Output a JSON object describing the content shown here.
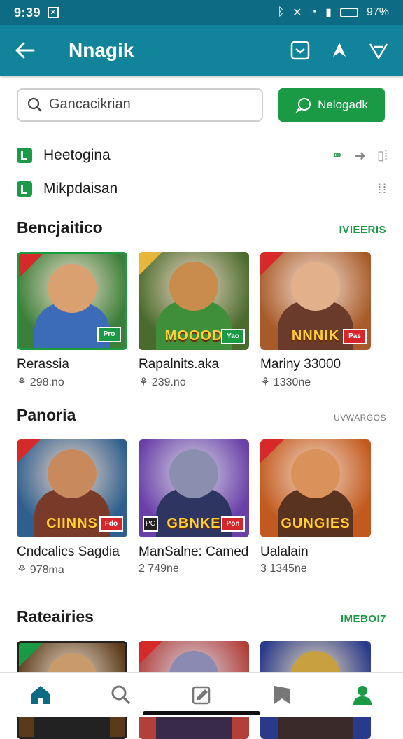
{
  "status_bar": {
    "time": "9:39",
    "battery": "97%"
  },
  "app_bar": {
    "title": "Nnagik"
  },
  "search": {
    "placeholder": "Gancacikrian"
  },
  "cta": {
    "label": "Nelogadk"
  },
  "links": [
    {
      "label": "Heetogina",
      "icon": "green-square-icon"
    },
    {
      "label": "Mikpdaisan",
      "icon": "green-square-icon"
    }
  ],
  "sections": [
    {
      "title": "Bencjaitico",
      "more": "IVIEERIS",
      "cards": [
        {
          "name": "Rerassia",
          "meta": "⚘ 298.no",
          "colors": {
            "bg": "#3b7f3a",
            "hero": "#d9a070",
            "body": "#3c6bb8"
          },
          "logo": "",
          "badge": "Pro",
          "badge_style": "green",
          "selected": true
        },
        {
          "name": "Rapalnits.aka",
          "meta": "⚘ 239.no",
          "colors": {
            "bg": "#4a6b2e",
            "hero": "#c98c4c",
            "body": "#3f8f3a"
          },
          "logo": "MOOOD",
          "badge": "Yao",
          "badge_style": "green",
          "selected": false
        },
        {
          "name": "Mariny 33000",
          "meta": "⚘ 1330ne",
          "colors": {
            "bg": "#a85b2a",
            "hero": "#e2b08a",
            "body": "#6a3a2a"
          },
          "logo": "NNNIK",
          "badge": "Pas",
          "badge_style": "red",
          "selected": false
        }
      ]
    },
    {
      "title": "Panoria",
      "more": "UVWARGOS",
      "cards": [
        {
          "name": "Cndcalics Sagdia",
          "meta": "⚘ 978ma",
          "colors": {
            "bg": "#2f5f8f",
            "hero": "#c88a5c",
            "body": "#7a3a2a"
          },
          "logo": "CIINNS",
          "badge": "Fdo",
          "badge_style": "red",
          "selected": false
        },
        {
          "name": "ManSalne: Cameda",
          "meta": "2 749ne",
          "colors": {
            "bg": "#6a3fa8",
            "hero": "#8a8fb0",
            "body": "#2e3560"
          },
          "logo": "GBNKE",
          "badge": "Pon",
          "badge_style": "red",
          "selected": false
        },
        {
          "name": "Ualalain",
          "meta": "3 1345ne",
          "colors": {
            "bg": "#c25a1f",
            "hero": "#d8925a",
            "body": "#5a3320"
          },
          "logo": "GUNGIES",
          "badge": "",
          "badge_style": "none",
          "selected": false
        }
      ]
    },
    {
      "title": "Rateairies",
      "more": "IMEBOI7",
      "cards": [
        {
          "colors": {
            "bg": "#5a3a1a",
            "hero": "#c99a6a",
            "body": "#222"
          }
        },
        {
          "colors": {
            "bg": "#b2403a",
            "hero": "#8a8ab2",
            "body": "#3a2a4a"
          }
        },
        {
          "colors": {
            "bg": "#2a3a8a",
            "hero": "#c8a040",
            "body": "#3a2a2a"
          }
        }
      ]
    }
  ],
  "bottom_nav": [
    "home-icon",
    "search-icon",
    "edit-icon",
    "bookmark-icon",
    "profile-icon"
  ],
  "accent": "#1a9a44",
  "appbar_color": "#11839a"
}
